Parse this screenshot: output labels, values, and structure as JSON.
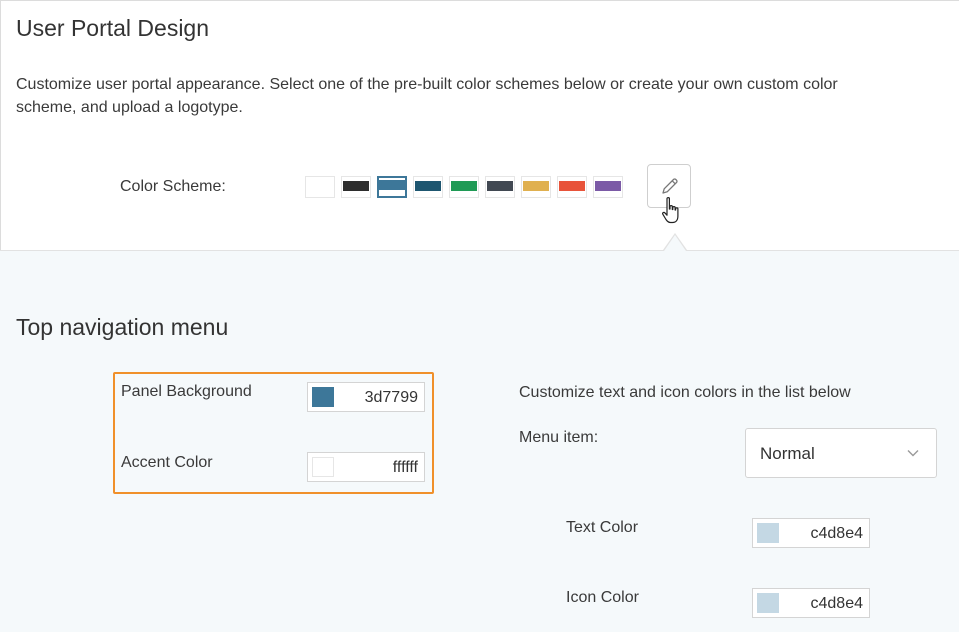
{
  "header": {
    "title": "User Portal Design",
    "description_line1": "Customize user portal appearance. Select one of the pre-built color schemes below or create your own custom color",
    "description_line2": "scheme, and upload a logotype."
  },
  "color_scheme": {
    "label": "Color Scheme:",
    "swatches": [
      "#ffffff",
      "#2d2d2d",
      "#3d7799",
      "#1e5670",
      "#1f9a55",
      "#414852",
      "#e0b04f",
      "#e8533a",
      "#7b5aa6"
    ],
    "selected_index": 2,
    "edit_icon": "pencil-icon",
    "cursor_icon": "hand-pointer-icon"
  },
  "top_nav": {
    "title": "Top navigation menu",
    "panel_background": {
      "label": "Panel Background",
      "value": "3d7799",
      "color": "#3d7799"
    },
    "accent_color": {
      "label": "Accent Color",
      "value": "ffffff",
      "color": "#ffffff"
    },
    "highlight_color": "#f0902a"
  },
  "menu_customization": {
    "note": "Customize text and icon colors in the list below",
    "menu_item_label": "Menu item:",
    "menu_item_value": "Normal",
    "dropdown_icon": "chevron-down-icon",
    "text_color": {
      "label": "Text Color",
      "value": "c4d8e4",
      "color": "#c4d8e4"
    },
    "icon_color": {
      "label": "Icon Color",
      "value": "c4d8e4",
      "color": "#c4d8e4"
    }
  }
}
